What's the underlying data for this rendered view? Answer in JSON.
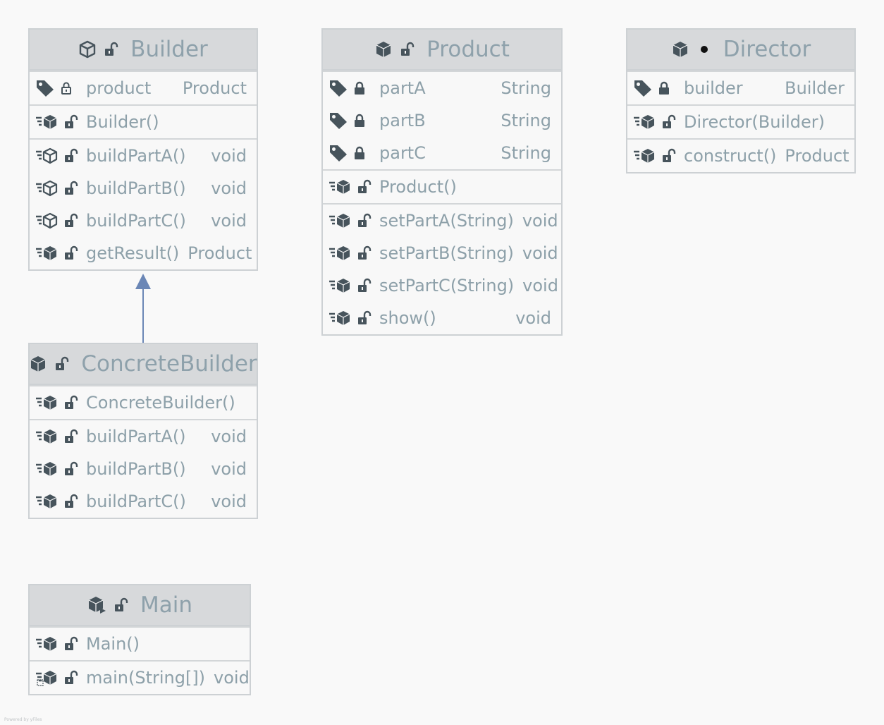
{
  "colors": {
    "text": "#8da0a9",
    "header": "#d7d9db",
    "border": "#cdd1d4",
    "icon": "#47545c",
    "arrow": "#6b87b6"
  },
  "classes": {
    "builder": {
      "title": "Builder",
      "fields": [
        {
          "name": "product",
          "type": "Product"
        }
      ],
      "constructors": [
        {
          "name": "Builder()",
          "type": ""
        }
      ],
      "methods": [
        {
          "name": "buildPartA()",
          "type": "void"
        },
        {
          "name": "buildPartB()",
          "type": "void"
        },
        {
          "name": "buildPartC()",
          "type": "void"
        },
        {
          "name": "getResult()",
          "type": "Product"
        }
      ]
    },
    "product": {
      "title": "Product",
      "fields": [
        {
          "name": "partA",
          "type": "String"
        },
        {
          "name": "partB",
          "type": "String"
        },
        {
          "name": "partC",
          "type": "String"
        }
      ],
      "constructors": [
        {
          "name": "Product()",
          "type": ""
        }
      ],
      "methods": [
        {
          "name": "setPartA(String)",
          "type": "void"
        },
        {
          "name": "setPartB(String)",
          "type": "void"
        },
        {
          "name": "setPartC(String)",
          "type": "void"
        },
        {
          "name": "show()",
          "type": "void"
        }
      ]
    },
    "director": {
      "title": "Director",
      "fields": [
        {
          "name": "builder",
          "type": "Builder"
        }
      ],
      "constructors": [
        {
          "name": "Director(Builder)",
          "type": ""
        }
      ],
      "methods": [
        {
          "name": "construct()",
          "type": "Product"
        }
      ]
    },
    "concrete_builder": {
      "title": "ConcreteBuilder",
      "constructors": [
        {
          "name": "ConcreteBuilder()",
          "type": ""
        }
      ],
      "methods": [
        {
          "name": "buildPartA()",
          "type": "void"
        },
        {
          "name": "buildPartB()",
          "type": "void"
        },
        {
          "name": "buildPartC()",
          "type": "void"
        }
      ]
    },
    "main": {
      "title": "Main",
      "constructors": [
        {
          "name": "Main()",
          "type": ""
        }
      ],
      "methods": [
        {
          "name": "main(String[])",
          "type": "void"
        }
      ]
    }
  },
  "footer": "Powered by yFiles"
}
